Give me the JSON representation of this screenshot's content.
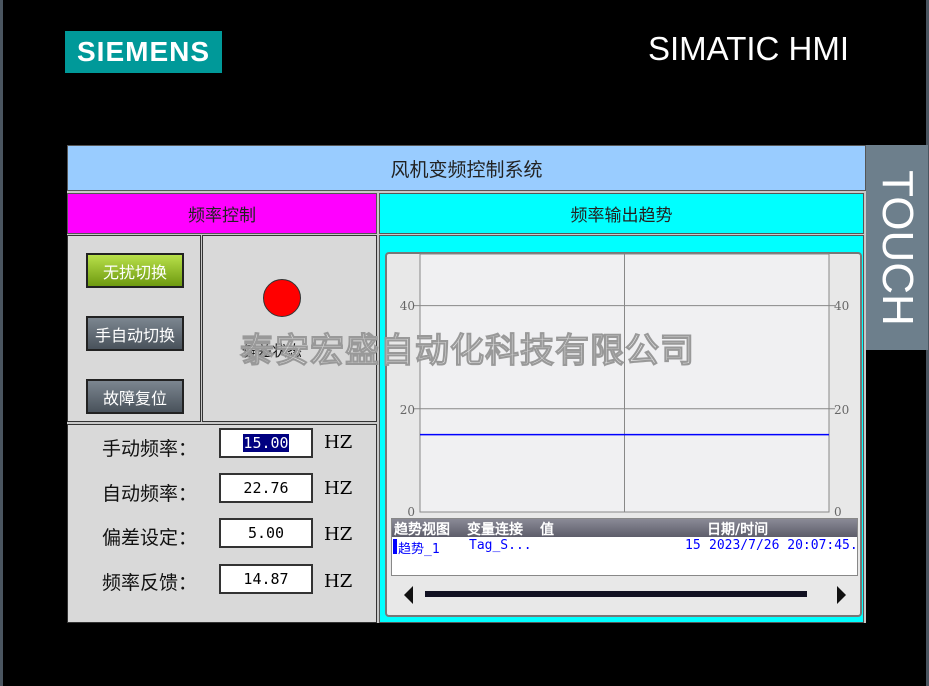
{
  "header": {
    "brand": "SIEMENS",
    "product": "SIMATIC HMI",
    "touch": "TOUCH"
  },
  "title": "风机变频控制系统",
  "left": {
    "title": "频率控制",
    "buttons": [
      "无扰切换",
      "手自动切换",
      "故障复位"
    ],
    "indicator": {
      "label": "偏差状态",
      "color": "#ff0000"
    },
    "fields": [
      {
        "label": "手动频率：",
        "value": "15.00",
        "unit": "HZ",
        "selected": true
      },
      {
        "label": "自动频率：",
        "value": "22.76",
        "unit": "HZ"
      },
      {
        "label": "偏差设定：",
        "value": "5.00",
        "unit": "HZ"
      },
      {
        "label": "频率反馈：",
        "value": "14.87",
        "unit": "HZ"
      }
    ]
  },
  "right": {
    "title": "频率输出趋势"
  },
  "chart_data": {
    "type": "line",
    "ylim": [
      0,
      50
    ],
    "yticks": [
      "0",
      "20",
      "40"
    ],
    "series": [
      {
        "name": "趋势_1",
        "values": [
          15,
          15
        ],
        "color": "#0000ff"
      }
    ],
    "grid": true
  },
  "trend_table": {
    "headers": [
      "趋势视图",
      "变量连接",
      "值",
      "日期/时间"
    ],
    "rows": [
      {
        "trend": "趋势_1",
        "tag": "Tag_S...",
        "value": "15",
        "datetime": "2023/7/26 20:07:45."
      }
    ]
  },
  "watermark": "泰安宏盛自动化科技有限公司",
  "colors": {
    "title": "#99ccff",
    "left_header": "#ff00ff",
    "right_header": "#00ffff"
  }
}
